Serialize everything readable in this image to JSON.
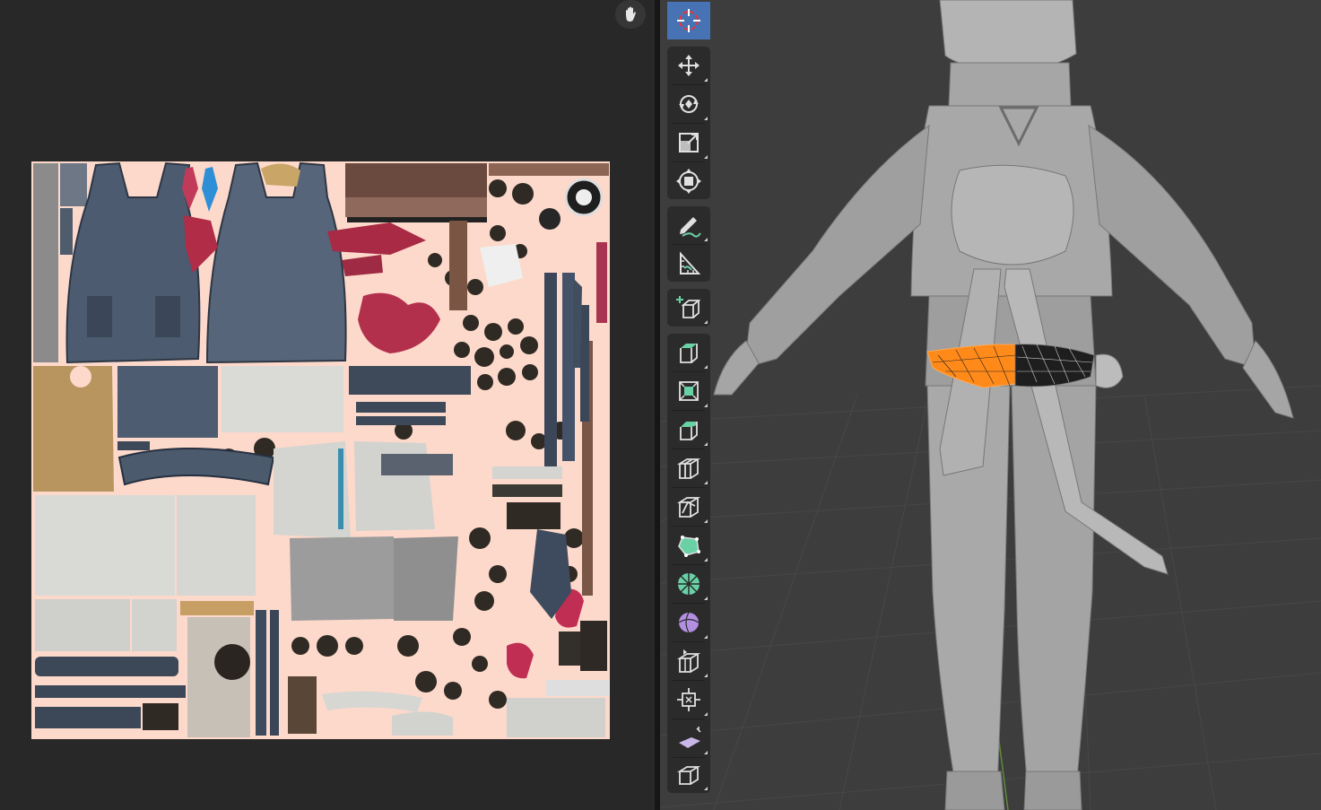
{
  "window": {
    "left_editor": "uv-editor",
    "right_editor": "3d-viewport"
  },
  "uv_editor": {
    "navigation_icon": "hand-icon"
  },
  "toolbar": {
    "tools": [
      {
        "id": "cursor",
        "icon": "cursor-icon",
        "active": true
      },
      {
        "id": "move",
        "icon": "move-icon",
        "active": false
      },
      {
        "id": "rotate",
        "icon": "rotate-icon",
        "active": false
      },
      {
        "id": "scale",
        "icon": "scale-icon",
        "active": false
      },
      {
        "id": "transform",
        "icon": "transform-icon",
        "active": false
      },
      {
        "id": "annotate",
        "icon": "annotate-icon",
        "active": false
      },
      {
        "id": "measure",
        "icon": "measure-icon",
        "active": false
      },
      {
        "id": "add-cube",
        "icon": "add-cube-icon",
        "active": false
      },
      {
        "id": "extrude-region",
        "icon": "extrude-region-icon",
        "active": false
      },
      {
        "id": "inset-faces",
        "icon": "inset-faces-icon",
        "active": false
      },
      {
        "id": "bevel",
        "icon": "bevel-icon",
        "active": false
      },
      {
        "id": "loop-cut",
        "icon": "loop-cut-icon",
        "active": false
      },
      {
        "id": "knife",
        "icon": "knife-icon",
        "active": false
      },
      {
        "id": "poly-build",
        "icon": "poly-build-icon",
        "active": false
      },
      {
        "id": "spin",
        "icon": "spin-icon",
        "active": false
      },
      {
        "id": "smooth",
        "icon": "smooth-icon",
        "active": false
      },
      {
        "id": "edge-slide",
        "icon": "edge-slide-icon",
        "active": false
      },
      {
        "id": "shrink-fatten",
        "icon": "shrink-fatten-icon",
        "active": false
      },
      {
        "id": "shear",
        "icon": "shear-icon",
        "active": false
      },
      {
        "id": "rip-region",
        "icon": "rip-region-icon",
        "active": false
      }
    ]
  },
  "colors": {
    "accent": "#4772b3",
    "selection": "#ff8a1a",
    "uv_background": "#fdd9cb",
    "viewport_background": "#3d3d3d",
    "model": "#a8a8a8"
  }
}
